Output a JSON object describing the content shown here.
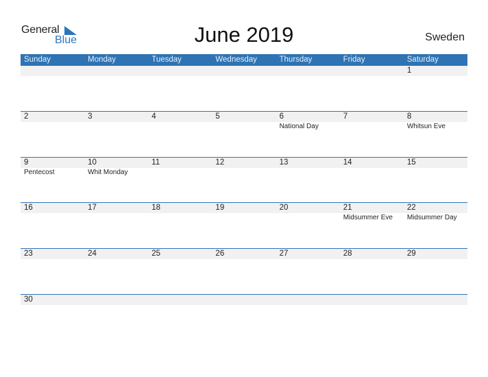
{
  "logo": {
    "line1": "General",
    "line2": "Blue",
    "accent_color": "#2a75c2"
  },
  "title": "June 2019",
  "country": "Sweden",
  "colors": {
    "header_bg": "#2e73b3",
    "band_bg": "#f1f1f1"
  },
  "weekdays": [
    "Sunday",
    "Monday",
    "Tuesday",
    "Wednesday",
    "Thursday",
    "Friday",
    "Saturday"
  ],
  "weeks": [
    [
      {
        "day": "",
        "holiday": ""
      },
      {
        "day": "",
        "holiday": ""
      },
      {
        "day": "",
        "holiday": ""
      },
      {
        "day": "",
        "holiday": ""
      },
      {
        "day": "",
        "holiday": ""
      },
      {
        "day": "",
        "holiday": ""
      },
      {
        "day": "1",
        "holiday": ""
      }
    ],
    [
      {
        "day": "2",
        "holiday": ""
      },
      {
        "day": "3",
        "holiday": ""
      },
      {
        "day": "4",
        "holiday": ""
      },
      {
        "day": "5",
        "holiday": ""
      },
      {
        "day": "6",
        "holiday": "National Day"
      },
      {
        "day": "7",
        "holiday": ""
      },
      {
        "day": "8",
        "holiday": "Whitsun Eve"
      }
    ],
    [
      {
        "day": "9",
        "holiday": "Pentecost"
      },
      {
        "day": "10",
        "holiday": "Whit Monday"
      },
      {
        "day": "11",
        "holiday": ""
      },
      {
        "day": "12",
        "holiday": ""
      },
      {
        "day": "13",
        "holiday": ""
      },
      {
        "day": "14",
        "holiday": ""
      },
      {
        "day": "15",
        "holiday": ""
      }
    ],
    [
      {
        "day": "16",
        "holiday": ""
      },
      {
        "day": "17",
        "holiday": ""
      },
      {
        "day": "18",
        "holiday": ""
      },
      {
        "day": "19",
        "holiday": ""
      },
      {
        "day": "20",
        "holiday": ""
      },
      {
        "day": "21",
        "holiday": "Midsummer Eve"
      },
      {
        "day": "22",
        "holiday": "Midsummer Day"
      }
    ],
    [
      {
        "day": "23",
        "holiday": ""
      },
      {
        "day": "24",
        "holiday": ""
      },
      {
        "day": "25",
        "holiday": ""
      },
      {
        "day": "26",
        "holiday": ""
      },
      {
        "day": "27",
        "holiday": ""
      },
      {
        "day": "28",
        "holiday": ""
      },
      {
        "day": "29",
        "holiday": ""
      }
    ],
    [
      {
        "day": "30",
        "holiday": ""
      },
      {
        "day": "",
        "holiday": ""
      },
      {
        "day": "",
        "holiday": ""
      },
      {
        "day": "",
        "holiday": ""
      },
      {
        "day": "",
        "holiday": ""
      },
      {
        "day": "",
        "holiday": ""
      },
      {
        "day": "",
        "holiday": ""
      }
    ]
  ]
}
